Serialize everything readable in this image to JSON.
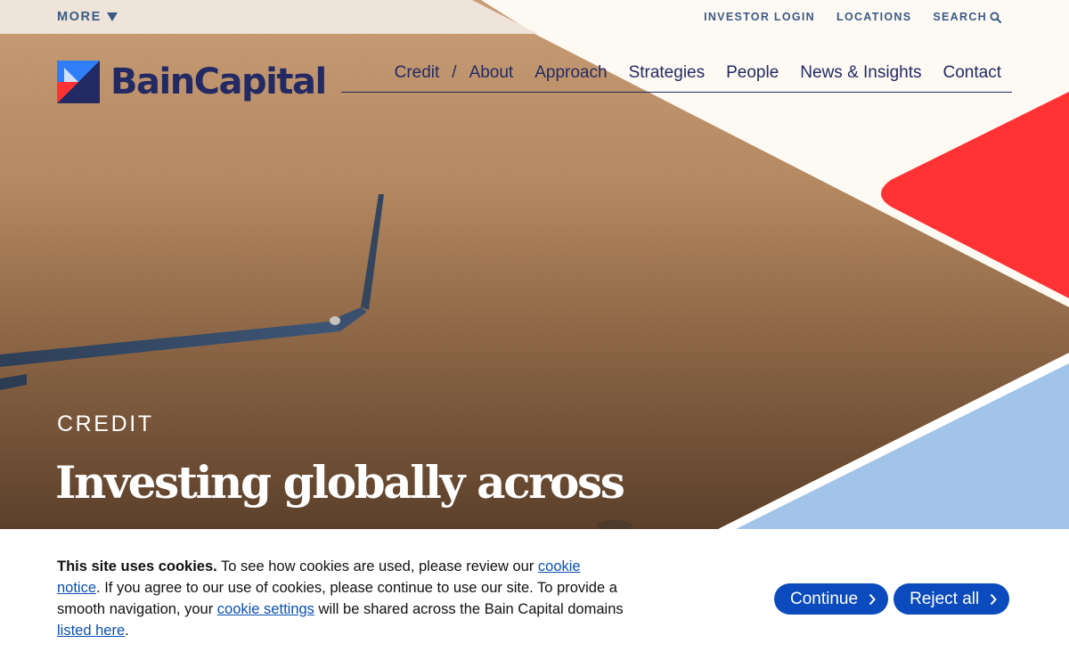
{
  "topbar": {
    "more_label": "MORE",
    "investor_login": "INVESTOR LOGIN",
    "locations": "LOCATIONS",
    "search": "SEARCH"
  },
  "logo": {
    "text": "BainCapital"
  },
  "nav": {
    "current_section": "Credit",
    "separator": "/",
    "items": [
      {
        "label": "About"
      },
      {
        "label": "Approach"
      },
      {
        "label": "Strategies"
      },
      {
        "label": "People"
      },
      {
        "label": "News & Insights"
      },
      {
        "label": "Contact"
      }
    ]
  },
  "hero": {
    "eyebrow": "CREDIT",
    "title": "Investing globally across"
  },
  "cookie": {
    "bold": "This site uses cookies.",
    "text1": " To see how cookies are used, please review our ",
    "link1": "cookie notice",
    "text2": ". If you agree to our use of cookies, please continue to use our site. To provide a smooth navigation, your ",
    "link2": "cookie settings",
    "text3": " will be shared across the Bain Capital domains ",
    "link3": "listed here",
    "text4": ".",
    "continue_label": "Continue",
    "reject_label": "Reject all"
  },
  "colors": {
    "brand_navy": "#232a63",
    "brand_red": "#ff3333",
    "brand_blue": "#3b82f6",
    "link_blue": "#0a4fb3",
    "button_blue": "#0b4bbd",
    "cream": "#fdf9f3",
    "light_blue": "#a2c4e8"
  },
  "icons": {
    "more": "caret-down-icon",
    "search": "search-icon",
    "logo": "bain-capital-logo-mark",
    "button_arrow": "chevron-right-icon"
  }
}
